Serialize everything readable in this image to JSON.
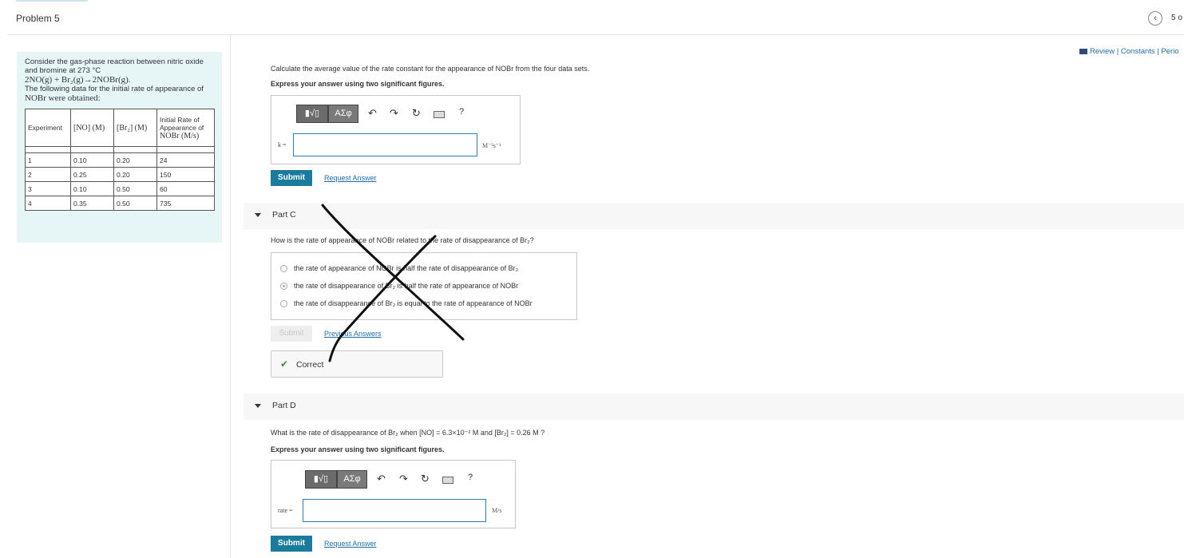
{
  "header": {
    "problem_title": "Problem 5",
    "page_count": "5 o",
    "prev_icon": "chevron-left-icon"
  },
  "review": {
    "links": "Review | Constants | Perio"
  },
  "sidebar": {
    "intro": "Consider the gas-phase reaction between nitric oxide and bromine at 273 °C",
    "equation": "2NO(g) + Br₂(g)→2NOBr(g).",
    "data_intro_1": "The following data for the initial rate of appearance of",
    "data_intro_2": "NOBr were obtained:",
    "table": {
      "headers": [
        "Experiment",
        "[NO] (M)",
        "[Br₂] (M)",
        "Initial Rate of Appearance of",
        "NOBr (M/s)"
      ],
      "rows": [
        [
          "1",
          "0.10",
          "0.20",
          "24"
        ],
        [
          "2",
          "0.25",
          "0.20",
          "150"
        ],
        [
          "3",
          "0.10",
          "0.50",
          "60"
        ],
        [
          "4",
          "0.35",
          "0.50",
          "735"
        ]
      ]
    }
  },
  "part_b": {
    "question": "Calculate the average value of the rate constant for the appearance of NOBr from the four data sets.",
    "instruction": "Express your answer using two significant figures.",
    "input_label": "k =",
    "input_value": "",
    "unit": "M⁻²s⁻¹",
    "submit": "Submit",
    "request_answer": "Request Answer"
  },
  "toolbar": {
    "templates": "▮√▯",
    "symbols": "ΑΣφ",
    "undo": "↶",
    "redo": "↷",
    "reset": "↻",
    "help": "?"
  },
  "part_c": {
    "label": "Part C",
    "question": "How is the rate of appearance of NOBr related to the rate of disappearance of Br₂?",
    "options": [
      "the rate of appearance of NOBr is half the rate of disappearance of Br₂",
      "the rate of disappearance of Br₂ is half the rate of appearance of NOBr",
      "the rate of disappearance of Br₂ is equal to the rate of appearance of NOBr"
    ],
    "selected_index": 1,
    "submit": "Submit",
    "previous_answers": "Previous Answers",
    "result": "Correct"
  },
  "part_d": {
    "label": "Part D",
    "question": "What is the rate of disappearance of Br₂ when [NO] = 6.3×10⁻² M and [Br₂] = 0.26 M ?",
    "instruction": "Express your answer using two significant figures.",
    "input_label": "rate =",
    "input_value": "",
    "unit": "M/s",
    "submit": "Submit",
    "request_answer": "Request Answer"
  },
  "colors": {
    "accent": "#1a7b9c",
    "sidebar_bg": "#e6f6f7",
    "link": "#1f6eaa",
    "correct": "#3b8a2f"
  }
}
